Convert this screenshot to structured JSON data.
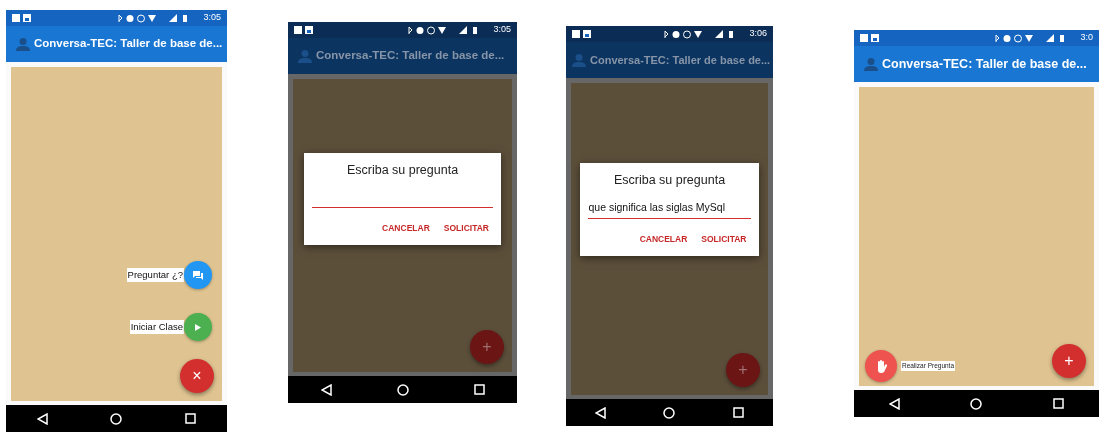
{
  "screens": [
    {
      "time": "3:05",
      "title": "Conversa-TEC: Taller de base de...",
      "dimmed": false,
      "speed_dial": [
        {
          "label": "Preguntar ¿?",
          "kind": "chat",
          "color": "#2196f3"
        },
        {
          "label": "Iniciar Clase",
          "kind": "play",
          "color": "#4caf50"
        }
      ],
      "main_fab": "×"
    },
    {
      "time": "3:05",
      "title": "Conversa-TEC: Taller de base de...",
      "dimmed": true,
      "dialog": {
        "title": "Escriba su pregunta",
        "buttons": [
          "CANCELAR",
          "SOLICITAR"
        ]
      },
      "main_fab": "+"
    },
    {
      "time": "3:06",
      "title": "Conversa-TEC: Taller de base de...",
      "dimmed": true,
      "dialog": {
        "title": "Escriba su pregunta",
        "value": "que significa las siglas MySql",
        "buttons": [
          "CANCELAR",
          "SOLICITAR"
        ]
      },
      "main_fab": "+"
    },
    {
      "time": "3:0",
      "title": "Conversa-TEC: Taller de base de...",
      "dimmed": false,
      "side_action": {
        "label": "Realizar Pregunta",
        "kind": "hand",
        "color": "#ef5350"
      },
      "main_fab": "+"
    }
  ]
}
